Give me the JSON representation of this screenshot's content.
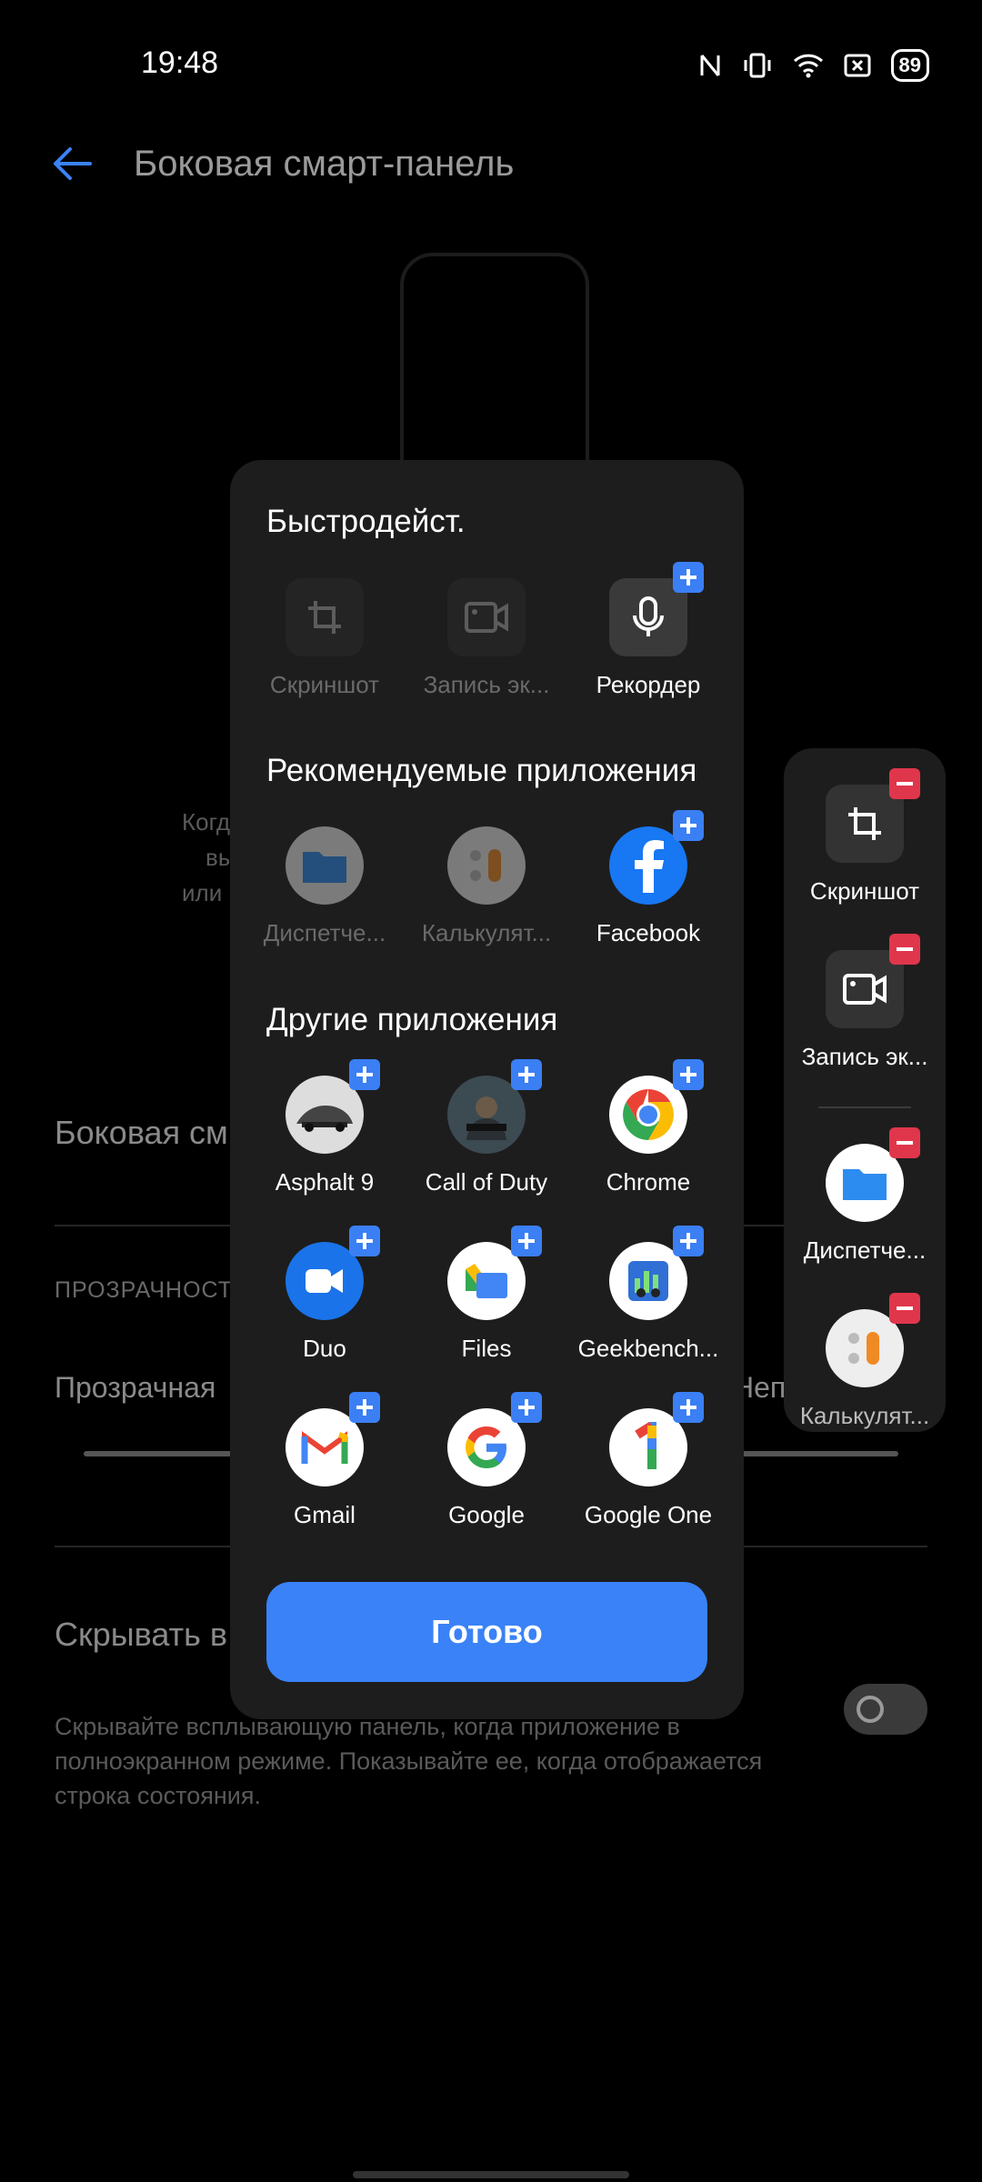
{
  "status": {
    "time": "19:48",
    "battery": "89"
  },
  "header": {
    "title": "Боковая смарт-панель"
  },
  "background": {
    "desc_lines": [
      "Когд",
      "вы",
      "или"
    ],
    "row_title": "Боковая см",
    "section_caption": "ПРОЗРАЧНОСТ",
    "slider_left": "Прозрачная",
    "slider_right": "Неп",
    "hide_title": "Скрывать в приложени",
    "hide_desc": "Скрывайте всплывающую панель, когда приложение в полноэкранном режиме. Показывайте ее, когда отображается строка состояния."
  },
  "sheet": {
    "quick_heading": "Быстродейст.",
    "quick": [
      {
        "label": "Скриншот",
        "icon": "screenshot-icon"
      },
      {
        "label": "Запись эк...",
        "icon": "screen-record-icon"
      },
      {
        "label": "Рекордер",
        "icon": "microphone-icon"
      }
    ],
    "recommended_heading": "Рекомендуемые приложения",
    "recommended": [
      {
        "label": "Диспетче...",
        "icon": "file-manager-icon"
      },
      {
        "label": "Калькулят...",
        "icon": "calculator-icon"
      },
      {
        "label": "Facebook",
        "icon": "facebook-icon"
      }
    ],
    "other_heading": "Другие приложения",
    "other": [
      {
        "label": "Asphalt 9",
        "icon": "asphalt-icon"
      },
      {
        "label": "Call of Duty",
        "icon": "call-of-duty-icon"
      },
      {
        "label": "Chrome",
        "icon": "chrome-icon"
      },
      {
        "label": "Duo",
        "icon": "duo-icon"
      },
      {
        "label": "Files",
        "icon": "files-icon"
      },
      {
        "label": "Geekbench...",
        "icon": "geekbench-icon"
      },
      {
        "label": "Gmail",
        "icon": "gmail-icon"
      },
      {
        "label": "Google",
        "icon": "google-icon"
      },
      {
        "label": "Google One",
        "icon": "google-one-icon"
      }
    ],
    "done_label": "Готово"
  },
  "side_panel": {
    "items": [
      {
        "label": "Скриншот",
        "icon": "screenshot-icon"
      },
      {
        "label": "Запись эк...",
        "icon": "screen-record-icon"
      },
      {
        "label": "Диспетче...",
        "icon": "file-manager-icon"
      },
      {
        "label": "Калькулят...",
        "icon": "calculator-icon"
      }
    ]
  },
  "colors": {
    "accent": "#3a82f7",
    "badge_add": "#3b7ff5",
    "badge_remove": "#e0364c",
    "sheet_bg": "#1d1d1d"
  }
}
